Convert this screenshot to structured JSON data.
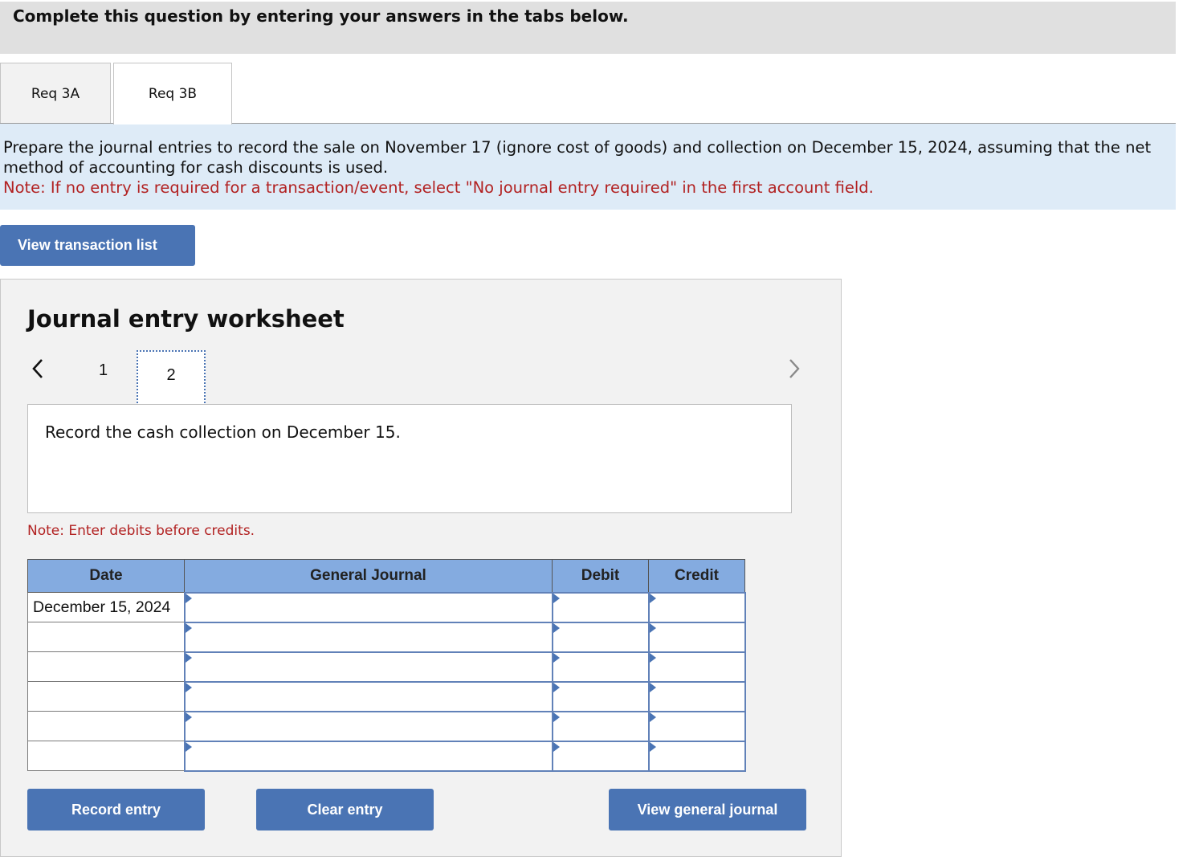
{
  "instructions": "Complete this question by entering your answers in the tabs below.",
  "tabs": [
    {
      "label": "Req 3A",
      "active": false
    },
    {
      "label": "Req 3B",
      "active": true
    }
  ],
  "question": {
    "text": "Prepare the journal entries to record the sale on November 17 (ignore cost of goods) and collection on December 15, 2024, assuming that the net method of accounting for cash discounts is used.",
    "note": "Note: If no entry is required for a transaction/event, select \"No journal entry required\" in the first account field."
  },
  "buttons": {
    "view_transaction_list": "View transaction list",
    "record_entry": "Record entry",
    "clear_entry": "Clear entry",
    "view_general_journal": "View general journal"
  },
  "worksheet": {
    "title": "Journal entry worksheet",
    "pages": [
      "1",
      "2"
    ],
    "current_page": "2",
    "description": "Record the cash collection on December 15.",
    "debit_note": "Note: Enter debits before credits.",
    "table": {
      "headers": [
        "Date",
        "General Journal",
        "Debit",
        "Credit"
      ],
      "rows": [
        {
          "date": "December 15, 2024",
          "account": "",
          "debit": "",
          "credit": ""
        },
        {
          "date": "",
          "account": "",
          "debit": "",
          "credit": ""
        },
        {
          "date": "",
          "account": "",
          "debit": "",
          "credit": ""
        },
        {
          "date": "",
          "account": "",
          "debit": "",
          "credit": ""
        },
        {
          "date": "",
          "account": "",
          "debit": "",
          "credit": ""
        },
        {
          "date": "",
          "account": "",
          "debit": "",
          "credit": ""
        }
      ]
    }
  },
  "colors": {
    "accent": "#4a74b4",
    "header_blue": "#84abe0",
    "note_red": "#b22222",
    "question_bg": "#deebf7"
  }
}
